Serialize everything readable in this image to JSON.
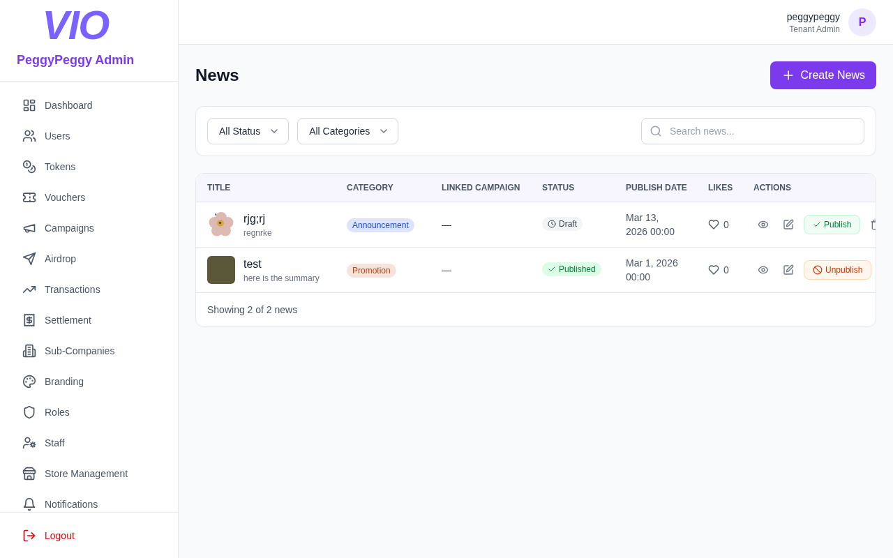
{
  "logo": {
    "text": "VIO"
  },
  "sidebar": {
    "title": "PeggyPeggy Admin",
    "items": [
      {
        "label": "Dashboard",
        "selected": false
      },
      {
        "label": "Users",
        "selected": false
      },
      {
        "label": "Tokens",
        "selected": false
      },
      {
        "label": "Vouchers",
        "selected": false
      },
      {
        "label": "Campaigns",
        "selected": false
      },
      {
        "label": "Airdrop",
        "selected": false
      },
      {
        "label": "Transactions",
        "selected": false
      },
      {
        "label": "Settlement",
        "selected": false
      },
      {
        "label": "Sub-Companies",
        "selected": false
      },
      {
        "label": "Branding",
        "selected": false
      },
      {
        "label": "Roles",
        "selected": false
      },
      {
        "label": "Staff",
        "selected": false
      },
      {
        "label": "Store Management",
        "selected": false
      },
      {
        "label": "Notifications",
        "selected": false
      }
    ],
    "logout": "Logout"
  },
  "header": {
    "user_name": "peggypeggy",
    "user_role": "Tenant Admin",
    "avatar_initial": "P"
  },
  "page": {
    "title": "News",
    "create_button": "Create News"
  },
  "filters": {
    "status_select": {
      "value": "All Status"
    },
    "category_select": {
      "value": "All Categories"
    },
    "search": {
      "placeholder": "Search news..."
    }
  },
  "table": {
    "columns": [
      "TITLE",
      "CATEGORY",
      "LINKED CAMPAIGN",
      "STATUS",
      "PUBLISH DATE",
      "LIKES",
      "ACTIONS"
    ],
    "rows": [
      {
        "title": "rjg;rj",
        "summary": "regnrke",
        "category": {
          "label": "Announcement",
          "color": "#1d4ed8"
        },
        "linked_campaign": "—",
        "status": {
          "label": "Draft",
          "kind": "draft"
        },
        "publish_date": "Mar 13, 2026 00:00",
        "likes": "0",
        "actions": [
          {
            "kind": "view"
          },
          {
            "kind": "edit"
          },
          {
            "kind": "publish",
            "label": "Publish"
          },
          {
            "kind": "delete"
          }
        ]
      },
      {
        "title": "test",
        "summary": "here is the summary",
        "category": {
          "label": "Promotion",
          "color": "#c2410c"
        },
        "linked_campaign": "—",
        "status": {
          "label": "Published",
          "kind": "published"
        },
        "publish_date": "Mar 1, 2026 00:00",
        "likes": "0",
        "actions": [
          {
            "kind": "view"
          },
          {
            "kind": "edit"
          },
          {
            "kind": "unpublish",
            "label": "Unpublish"
          }
        ]
      }
    ],
    "footer": "Showing 2 of 2 news"
  }
}
